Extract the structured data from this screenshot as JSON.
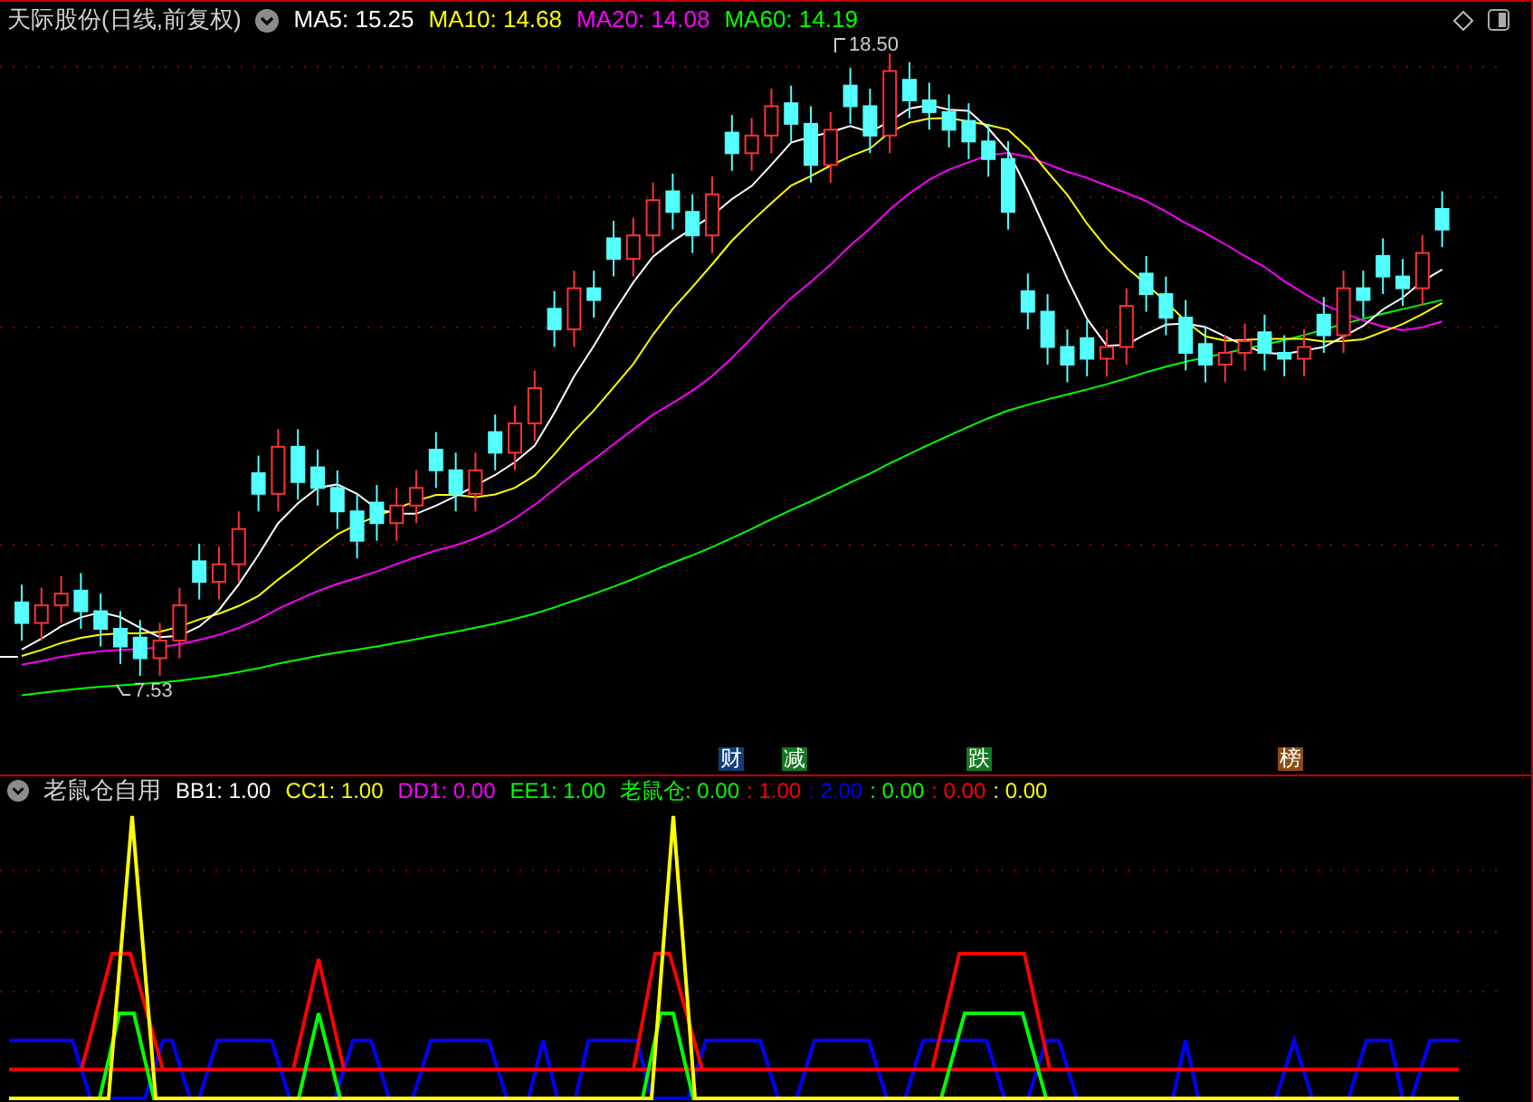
{
  "header": {
    "title": "天际股份(日线,前复权)",
    "indicators": [
      {
        "label": "MA5: 15.25",
        "color": "#ffffff"
      },
      {
        "label": "MA10: 14.68",
        "color": "#ffff00"
      },
      {
        "label": "MA20: 14.08",
        "color": "#ff00ff"
      },
      {
        "label": "MA60: 14.19",
        "color": "#00ff00"
      }
    ]
  },
  "price_markers": [
    {
      "text": "18.50"
    },
    {
      "text": "7.53"
    }
  ],
  "signals": [
    {
      "text": "财",
      "color": "#0f3f7a"
    },
    {
      "text": "减",
      "color": "#127a1e"
    },
    {
      "text": "跌",
      "color": "#127a1e"
    },
    {
      "text": "榜",
      "color": "#8a4d14"
    }
  ],
  "indicator_panel": {
    "title": "老鼠仓自用",
    "values": [
      {
        "text": "BB1: 1.00",
        "color": "#ffffff"
      },
      {
        "text": "CC1: 1.00",
        "color": "#ffff00"
      },
      {
        "text": "DD1: 0.00",
        "color": "#ff00ff"
      },
      {
        "text": "EE1: 1.00",
        "color": "#00ff00"
      },
      {
        "text": "老鼠仓: 0.00",
        "color": "#00ff00"
      },
      {
        "text": ": 1.00",
        "color": "#ff0000"
      },
      {
        "text": ": 2.00",
        "color": "#0000ff"
      },
      {
        "text": ": 0.00",
        "color": "#00ff00"
      },
      {
        "text": ": 0.00",
        "color": "#ff0000"
      },
      {
        "text": ": 0.00",
        "color": "#ffff00"
      }
    ]
  }
}
